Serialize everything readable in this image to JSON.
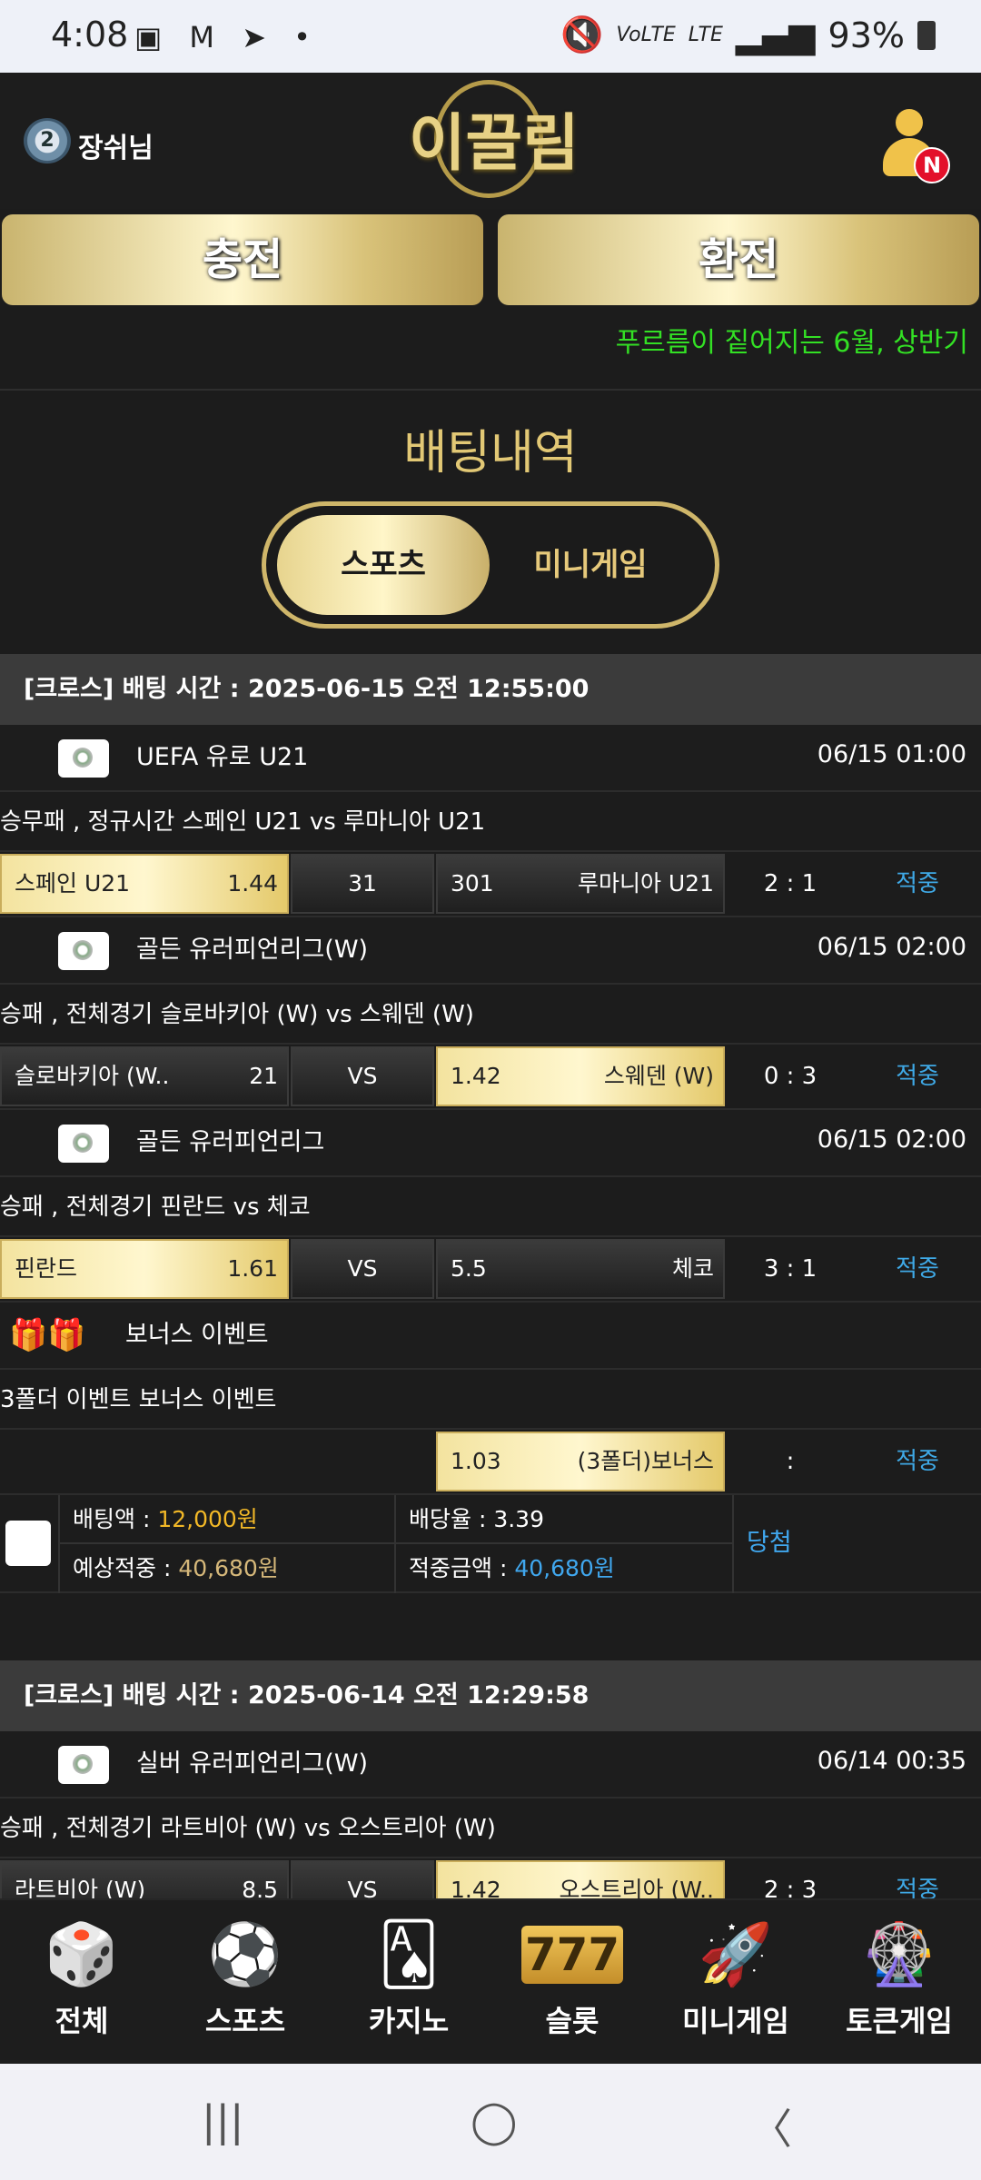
{
  "status_bar": {
    "time": "4:08",
    "notif_icons": "▣ M ➤ •",
    "network": "VoLTE",
    "network2": "LTE",
    "signal": "▂▄▆",
    "battery": "93%"
  },
  "header": {
    "rank_level": "2",
    "username": "장쉬님",
    "logo": "이끌림",
    "badge": "N"
  },
  "buttons": {
    "charge": "충전",
    "exchange": "환전"
  },
  "notice": "푸르름이 짙어지는 6월, 상반기",
  "page_title": "배팅내역",
  "tabs": {
    "sports": "스포츠",
    "minigame": "미니게임"
  },
  "bets": [
    {
      "header": "[크로스] 배팅 시간 : 2025-06-15 오전 12:55:00",
      "games": [
        {
          "league": "UEFA 유로 U21",
          "date": "06/15 01:00",
          "market": "승무패 , 정규시간 스페인 U21  vs  루마니아 U21",
          "home": "스페인 U21",
          "home_odds": "1.44",
          "draw": "31",
          "away_odds": "301",
          "away": "루마니아 U21",
          "score": "2 : 1",
          "result": "적중",
          "selected": "home"
        },
        {
          "league": "골든 유러피언리그(W)",
          "date": "06/15 02:00",
          "market": "승패 , 전체경기 슬로바키아 (W)  vs  스웨덴 (W)",
          "home": "슬로바키아 (W..",
          "home_odds": "21",
          "draw": "VS",
          "away_odds": "1.42",
          "away": "스웨덴 (W)",
          "score": "0 : 3",
          "result": "적중",
          "selected": "away"
        },
        {
          "league": "골든 유러피언리그",
          "date": "06/15 02:00",
          "market": "승패 , 전체경기 핀란드  vs  체코",
          "home": "핀란드",
          "home_odds": "1.61",
          "draw": "VS",
          "away_odds": "5.5",
          "away": "체코",
          "score": "3 : 1",
          "result": "적중",
          "selected": "home"
        }
      ],
      "bonus": {
        "league": "보너스 이벤트",
        "market": "3폴더 이벤트 보너스 이벤트",
        "away_odds": "1.03",
        "away": "(3폴더)보너스",
        "score": ":",
        "result": "적중"
      },
      "summary": {
        "bet_label": "배팅액 : ",
        "bet_amount": "12,000원",
        "rate_label": "배당율 : ",
        "rate": "3.39",
        "expected_label": "예상적중 : ",
        "expected": "40,680원",
        "win_label": "적중금액 : ",
        "win_amount": "40,680원",
        "status": "당첨"
      }
    },
    {
      "header": "[크로스] 배팅 시간 : 2025-06-14 오전 12:29:58",
      "games": [
        {
          "league": "실버 유러피언리그(W)",
          "date": "06/14 00:35",
          "market": "승패 , 전체경기 라트비아 (W)  vs  오스트리아 (W)",
          "home": "라트비아 (W)",
          "home_odds": "8.5",
          "draw": "VS",
          "away_odds": "1.42",
          "away": "오스트리아 (W..",
          "score": "2 : 3",
          "result": "적중",
          "selected": "away"
        }
      ]
    }
  ],
  "bottom_nav": [
    {
      "label": "전체",
      "icon": "dice-icon",
      "glyph": "🎲"
    },
    {
      "label": "스포츠",
      "icon": "soccer-ball-icon",
      "glyph": "⚽"
    },
    {
      "label": "카지노",
      "icon": "cards-icon",
      "glyph": "🂡"
    },
    {
      "label": "슬롯",
      "icon": "slot-777-icon",
      "glyph": "777"
    },
    {
      "label": "미니게임",
      "icon": "rocket-icon",
      "glyph": "🚀"
    },
    {
      "label": "토큰게임",
      "icon": "roulette-icon",
      "glyph": "🎡"
    }
  ],
  "android_nav": {
    "recents": "|||",
    "home": "◯",
    "back": "〈"
  }
}
